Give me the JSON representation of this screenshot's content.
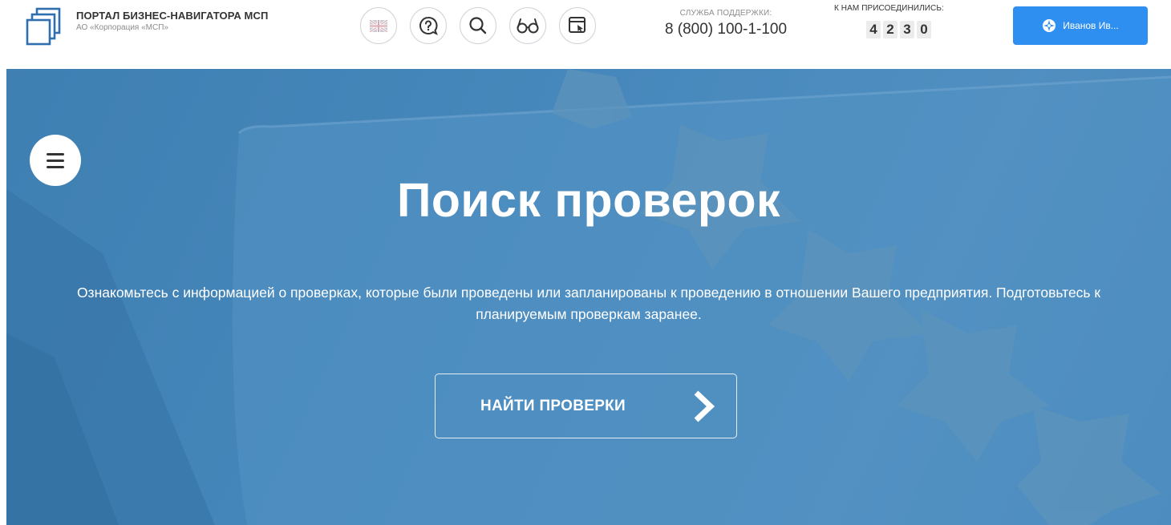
{
  "header": {
    "brand_title": "ПОРТАЛ БИЗНЕС-НАВИГАТОРА МСП",
    "brand_subtitle": "АО «Корпорация «МСП»",
    "icons": [
      "uk-flag-icon",
      "help-chat-icon",
      "search-icon",
      "glasses-icon",
      "screen-cursor-icon"
    ],
    "support_label": "СЛУЖБА ПОДДЕРЖКИ:",
    "support_phone": "8 (800) 100-1-100",
    "joined_label": "К НАМ ПРИСОЕДИНИЛИСЬ:",
    "joined_digits": [
      "4",
      "2",
      "3",
      "0"
    ],
    "user_name": "Иванов Ив...",
    "accent_color": "#2f8ff0"
  },
  "hero": {
    "title": "Поиск проверок",
    "description": "Ознакомьтесь с информацией о проверках, которые были проведены или запланированы к проведению в отношении Вашего предприятия. Подготовьтесь к планируемым проверкам заранее.",
    "button_label": "НАЙТИ ПРОВЕРКИ",
    "background_color": "#4c8dbf"
  }
}
